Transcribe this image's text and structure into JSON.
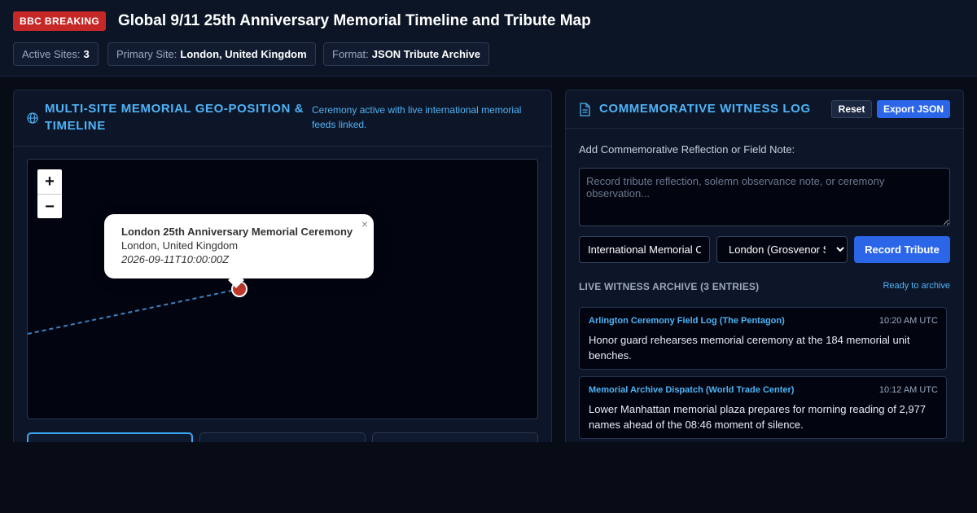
{
  "header": {
    "badge": "BBC BREAKING",
    "title": "Global 9/11 25th Anniversary Memorial Timeline and Tribute Map",
    "chips": [
      {
        "label": "Active Sites:",
        "value": "3"
      },
      {
        "label": "Primary Site:",
        "value": "London, United Kingdom"
      },
      {
        "label": "Format:",
        "value": "JSON Tribute Archive"
      }
    ]
  },
  "map_panel": {
    "title": "MULTI-SITE MEMORIAL GEO-POSITION & TIMELINE",
    "note": "Ceremony active with live international memorial feeds linked.",
    "zoom_in": "+",
    "zoom_out": "−",
    "popup": {
      "close": "×",
      "title": "London 25th Anniversary Memorial Ceremony",
      "location": "London, United Kingdom",
      "timestamp": "2026-09-11T10:00:00Z"
    },
    "marker_color": "#c0392b",
    "route_color": "#3b82c4"
  },
  "log_panel": {
    "title": "COMMEMORATIVE WITNESS LOG",
    "reset_label": "Reset",
    "export_label": "Export JSON",
    "field_label": "Add Commemorative Reflection or Field Note:",
    "reflection_placeholder": "Record tribute reflection, solemn observance note, or ceremony observation...",
    "source_value": "International Memorial Correspondent",
    "site_selected": "London (Grosvenor Square)",
    "record_label": "Record Tribute",
    "archive_heading": "LIVE WITNESS ARCHIVE (3 ENTRIES)",
    "archive_status": "Ready to archive",
    "entries": [
      {
        "source": "Arlington Ceremony Field Log (The Pentagon)",
        "time": "10:20 AM UTC",
        "text": "Honor guard rehearses memorial ceremony at the 184 memorial unit benches."
      },
      {
        "source": "Memorial Archive Dispatch (World Trade Center)",
        "time": "10:12 AM UTC",
        "text": "Lower Manhattan memorial plaza prepares for morning reading of 2,977 names ahead of the 08:46 moment of silence."
      }
    ]
  },
  "colors": {
    "accent": "#4fb3f6",
    "primary_button": "#2b66e8",
    "breaking": "#c62828"
  }
}
